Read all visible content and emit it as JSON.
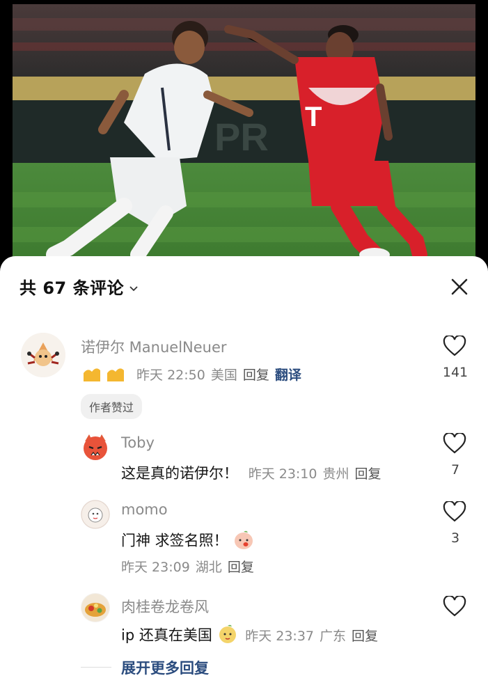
{
  "comments_header": {
    "title": "共 67 条评论",
    "close_icon": "close-icon",
    "chevron_icon": "chevron-down-icon"
  },
  "comments": [
    {
      "author": "诺伊尔 ManuelNeuer",
      "emoji": "flexed-biceps ×2",
      "time": "昨天 22:50",
      "location": "美国",
      "reply": "回复",
      "translate": "翻译",
      "likes": "141",
      "badge": "作者赞过"
    }
  ],
  "replies": [
    {
      "author": "Toby",
      "text": "这是真的诺伊尔！",
      "time": "昨天 23:10",
      "location": "贵州",
      "reply": "回复",
      "likes": "7"
    },
    {
      "author": "momo",
      "text": "门神 求签名照！",
      "time": "昨天 23:09",
      "location": "湖北",
      "reply": "回复",
      "likes": "3"
    },
    {
      "author": "肉桂卷龙卷风",
      "text": "ip 还真在美国",
      "time": "昨天 23:37",
      "location": "广东",
      "reply": "回复",
      "likes": ""
    }
  ],
  "expand_more": "展开更多回复",
  "colors": {
    "link": "#2b4c7e",
    "muted": "#8a8a8a",
    "jersey_red": "#d8202a"
  }
}
